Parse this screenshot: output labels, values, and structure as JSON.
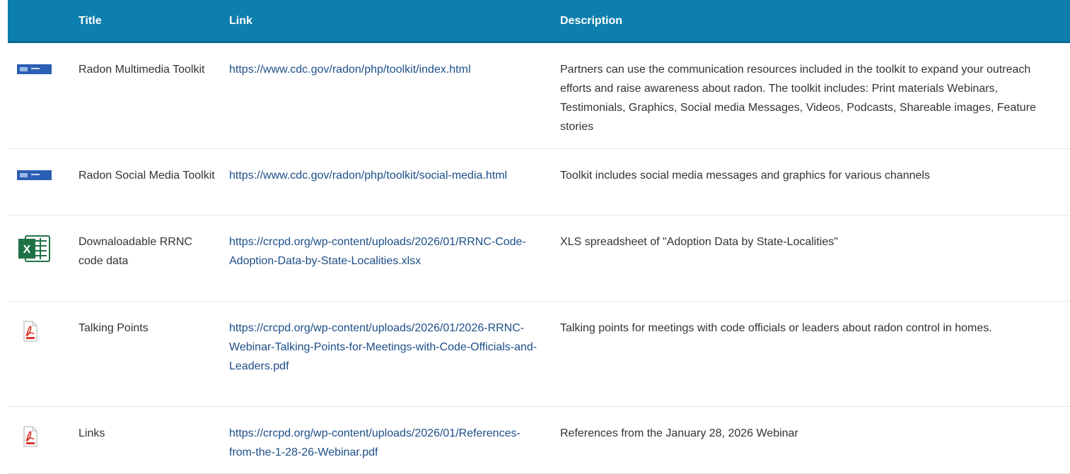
{
  "header": {
    "title": "Title",
    "link": "Link",
    "description": "Description"
  },
  "colors": {
    "header_bg": "#0d7fae",
    "link": "#1d4e89",
    "excel_green": "#1e7145",
    "pdf_red": "#d9342b"
  },
  "rows": [
    {
      "icon": "cdc-logo-icon",
      "title": "Radon Multimedia Toolkit",
      "link": "https://www.cdc.gov/radon/php/toolkit/index.html",
      "description": "Partners can use the communication resources included in the toolkit to expand your outreach efforts and raise awareness about radon. The toolkit includes: Print materials Webinars, Testimonials, Graphics, Social media Messages, Videos, Podcasts, Shareable images, Feature stories"
    },
    {
      "icon": "cdc-logo-icon",
      "title": "Radon Social Media Toolkit",
      "link": "https://www.cdc.gov/radon/php/toolkit/social-media.html",
      "description": "Toolkit includes social media messages and graphics for various channels"
    },
    {
      "icon": "excel-icon",
      "title": "Downaloadable RRNC code data",
      "link": "https://crcpd.org/wp-content/uploads/2026/01/RRNC-Code-Adoption-Data-by-State-Localities.xlsx",
      "description": "XLS spreadsheet of \"Adoption Data by State-Localities\""
    },
    {
      "icon": "pdf-icon",
      "title": "Talking Points",
      "link": "https://crcpd.org/wp-content/uploads/2026/01/2026-RRNC-Webinar-Talking-Points-for-Meetings-with-Code-Officials-and-Leaders.pdf",
      "description": "Talking points for meetings with code officials or leaders about radon control in homes."
    },
    {
      "icon": "pdf-icon",
      "title": "Links",
      "link": "https://crcpd.org/wp-content/uploads/2026/01/References-from-the-1-28-26-Webinar.pdf",
      "description": "References from the January 28, 2026 Webinar"
    }
  ]
}
